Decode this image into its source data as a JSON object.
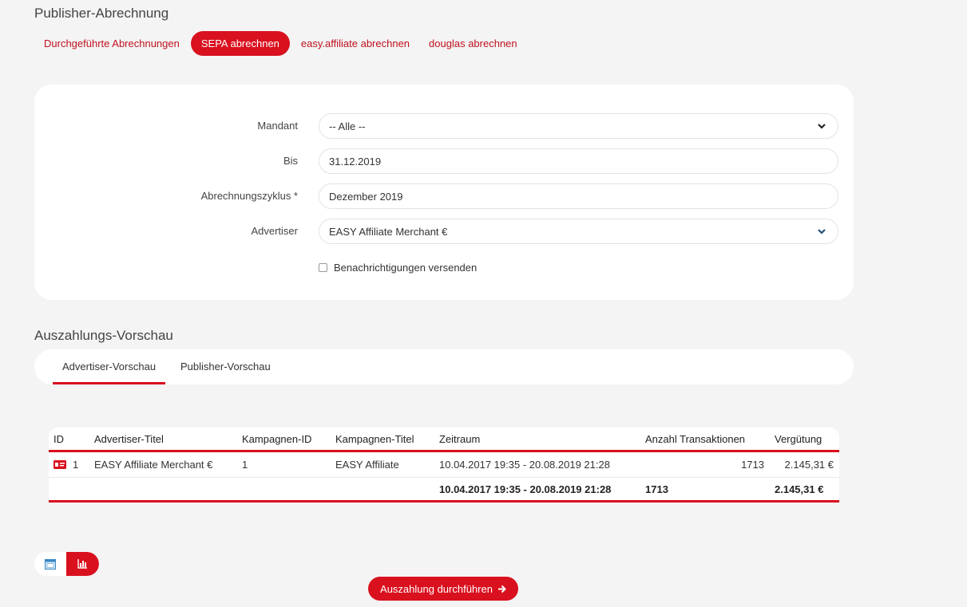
{
  "page": {
    "title": "Publisher-Abrechnung"
  },
  "subnav": [
    {
      "label": "Durchgeführte Abrechnungen",
      "active": false
    },
    {
      "label": "SEPA abrechnen",
      "active": true
    },
    {
      "label": "easy.affiliate abrechnen",
      "active": false
    },
    {
      "label": "douglas abrechnen",
      "active": false
    }
  ],
  "form": {
    "mandant": {
      "label": "Mandant",
      "value": "-- Alle --"
    },
    "bis": {
      "label": "Bis",
      "value": "31.12.2019"
    },
    "zyklus": {
      "label": "Abrechnungszyklus *",
      "value": "Dezember 2019"
    },
    "advertiser": {
      "label": "Advertiser",
      "value": "EASY Affiliate Merchant €"
    },
    "notify": {
      "label": "Benachrichtigungen versenden",
      "checked": false
    }
  },
  "preview": {
    "title": "Auszahlungs-Vorschau",
    "tabs": [
      {
        "label": "Advertiser-Vorschau",
        "active": true
      },
      {
        "label": "Publisher-Vorschau",
        "active": false
      }
    ],
    "columns": [
      "ID",
      "Advertiser-Titel",
      "Kampagnen-ID",
      "Kampagnen-Titel",
      "Zeitraum",
      "Anzahl Transaktionen",
      "Vergütung"
    ],
    "rows": [
      {
        "id": "1",
        "advertiser": "EASY Affiliate Merchant €",
        "kampagnen_id": "1",
        "kampagnen_titel": "EASY Affiliate",
        "zeitraum": "10.04.2017 19:35 - 20.08.2019 21:28",
        "transaktionen": "1713",
        "verguetung": "2.145,31 €"
      }
    ],
    "summary": {
      "zeitraum": "10.04.2017 19:35 - 20.08.2019 21:28",
      "transaktionen": "1713",
      "verguetung": "2.145,31 €"
    }
  },
  "icons": {
    "chevron": "chevron-down-icon",
    "id_card": "id-card-icon",
    "table_view": "table-view-icon",
    "chart_view": "bar-chart-icon",
    "arrow": "arrow-right-icon"
  },
  "colors": {
    "accent": "#d9101e",
    "background": "#f4f4f4",
    "card": "#ffffff"
  },
  "actions": {
    "pay_label": "Auszahlung durchführen"
  }
}
